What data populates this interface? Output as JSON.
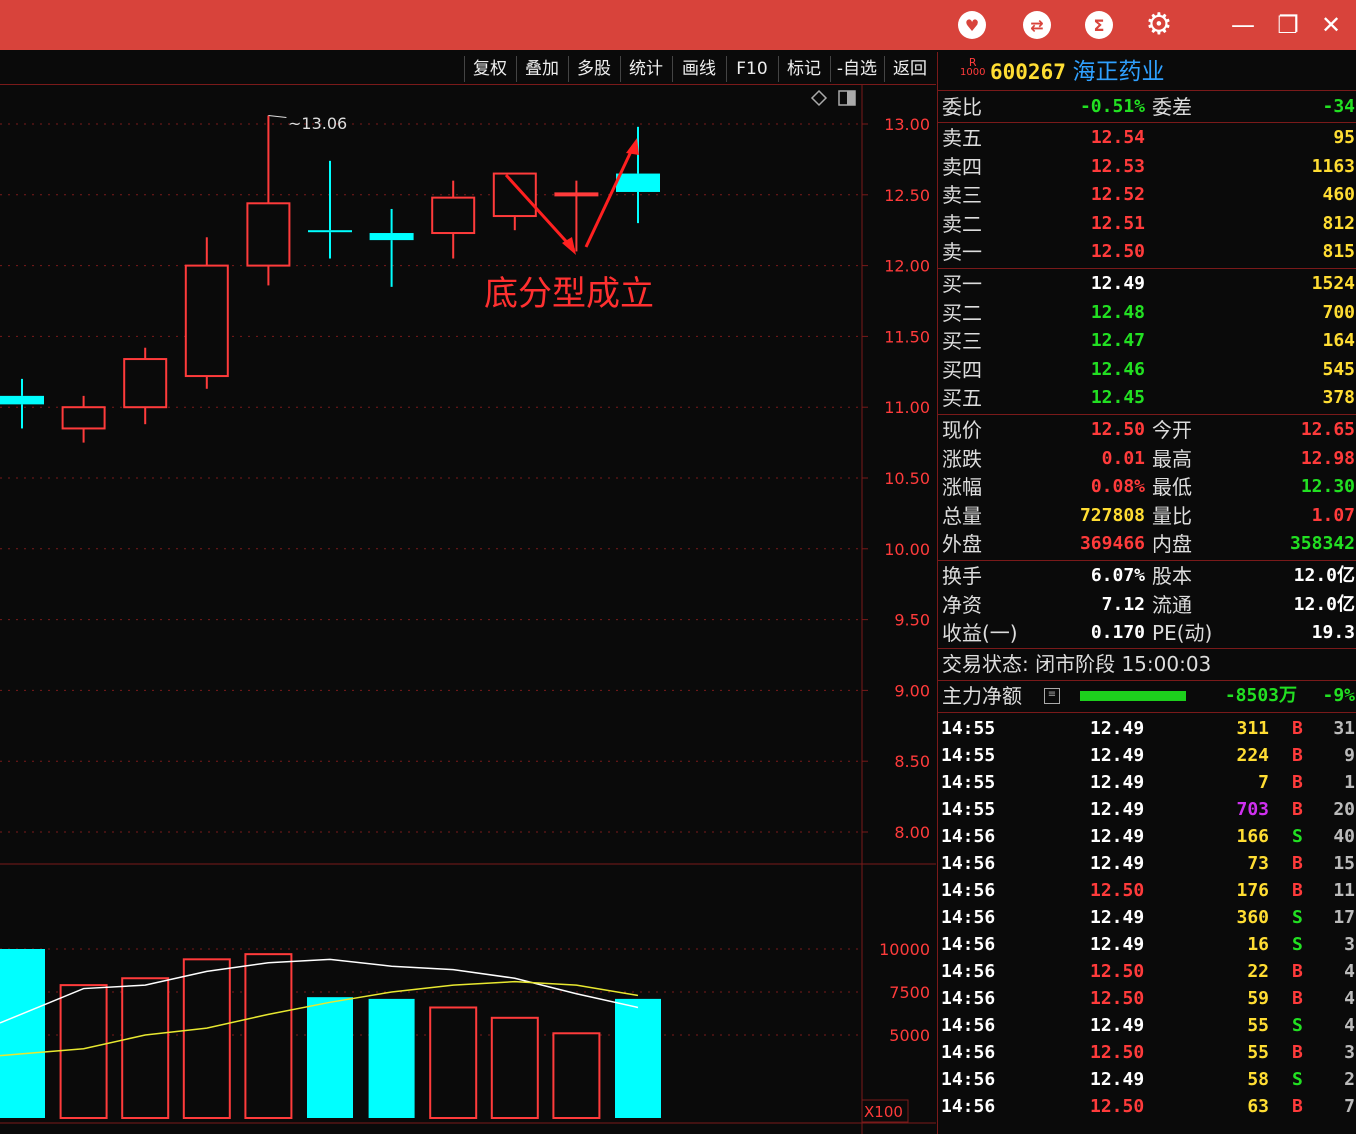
{
  "toolbar": {
    "buttons": [
      "复权",
      "叠加",
      "多股",
      "统计",
      "画线",
      "F10",
      "标记",
      "-自选",
      "返回"
    ],
    "window_controls": {
      "minimize": "—",
      "restore": "❐",
      "close": "✕"
    }
  },
  "chart": {
    "price_axis_labels": [
      "13.00",
      "12.50",
      "12.00",
      "11.50",
      "11.00",
      "10.50",
      "10.00",
      "9.50",
      "9.00",
      "8.50",
      "8.00"
    ],
    "volume_axis_labels": [
      "10000",
      "7500",
      "5000"
    ],
    "volume_unit": "X100",
    "high_marker": "13.06",
    "annotation": "底分型成立"
  },
  "chart_data": {
    "type": "candlestick",
    "candles": [
      {
        "open": 11.08,
        "close": 11.02,
        "high": 11.2,
        "low": 10.85,
        "color": "cyan"
      },
      {
        "open": 10.85,
        "close": 11.0,
        "high": 11.08,
        "low": 10.75,
        "color": "red"
      },
      {
        "open": 11.0,
        "close": 11.34,
        "high": 11.42,
        "low": 10.88,
        "color": "red"
      },
      {
        "open": 11.22,
        "close": 12.0,
        "high": 12.2,
        "low": 11.13,
        "color": "red"
      },
      {
        "open": 12.0,
        "close": 12.44,
        "high": 13.06,
        "low": 11.86,
        "color": "red"
      },
      {
        "open": 12.25,
        "close": 12.24,
        "high": 12.74,
        "low": 12.05,
        "color": "cyan"
      },
      {
        "open": 12.23,
        "close": 12.18,
        "high": 12.4,
        "low": 11.85,
        "color": "cyan"
      },
      {
        "open": 12.23,
        "close": 12.48,
        "high": 12.6,
        "low": 12.05,
        "color": "red"
      },
      {
        "open": 12.35,
        "close": 12.65,
        "high": 12.65,
        "low": 12.25,
        "color": "red"
      },
      {
        "open": 12.5,
        "close": 12.51,
        "high": 12.6,
        "low": 12.1,
        "color": "red"
      },
      {
        "open": 12.65,
        "close": 12.52,
        "high": 12.98,
        "low": 12.3,
        "color": "cyan"
      }
    ],
    "volume": [
      {
        "value": 10000,
        "color": "cyan"
      },
      {
        "value": 7900,
        "color": "red"
      },
      {
        "value": 8300,
        "color": "red"
      },
      {
        "value": 9400,
        "color": "red"
      },
      {
        "value": 9700,
        "color": "red"
      },
      {
        "value": 7200,
        "color": "cyan"
      },
      {
        "value": 7100,
        "color": "cyan"
      },
      {
        "value": 6600,
        "color": "red"
      },
      {
        "value": 6000,
        "color": "red"
      },
      {
        "value": 5100,
        "color": "red"
      },
      {
        "value": 7100,
        "color": "cyan"
      }
    ],
    "vol_ma_white": [
      5700,
      7700,
      7900,
      8700,
      9200,
      9400,
      9000,
      8800,
      8300,
      7400,
      6600
    ],
    "vol_ma_yellow": [
      3800,
      4200,
      5000,
      5400,
      6200,
      6900,
      7500,
      7900,
      8100,
      7900,
      7300
    ],
    "price_range": [
      7.9,
      13.2
    ],
    "volume_range": [
      0,
      13000
    ]
  },
  "quote": {
    "code": "600267",
    "name": "海正药业",
    "badge_top": "R",
    "badge_bottom": "1000",
    "weibi_label": "委比",
    "weibi": "-0.51%",
    "weicha_label": "委差",
    "weicha": "-34",
    "asks": [
      {
        "label": "卖五",
        "price": "12.54",
        "vol": "95"
      },
      {
        "label": "卖四",
        "price": "12.53",
        "vol": "1163"
      },
      {
        "label": "卖三",
        "price": "12.52",
        "vol": "460"
      },
      {
        "label": "卖二",
        "price": "12.51",
        "vol": "812"
      },
      {
        "label": "卖一",
        "price": "12.50",
        "vol": "815"
      }
    ],
    "bids": [
      {
        "label": "买一",
        "price": "12.49",
        "vol": "1524"
      },
      {
        "label": "买二",
        "price": "12.48",
        "vol": "700"
      },
      {
        "label": "买三",
        "price": "12.47",
        "vol": "164"
      },
      {
        "label": "买四",
        "price": "12.46",
        "vol": "545"
      },
      {
        "label": "买五",
        "price": "12.45",
        "vol": "378"
      }
    ],
    "stats": [
      {
        "l1": "现价",
        "v1": "12.50",
        "c1": "red",
        "l2": "今开",
        "v2": "12.65",
        "c2": "red"
      },
      {
        "l1": "涨跌",
        "v1": "0.01",
        "c1": "red",
        "l2": "最高",
        "v2": "12.98",
        "c2": "red"
      },
      {
        "l1": "涨幅",
        "v1": "0.08%",
        "c1": "red",
        "l2": "最低",
        "v2": "12.30",
        "c2": "green"
      },
      {
        "l1": "总量",
        "v1": "727808",
        "c1": "yellow",
        "l2": "量比",
        "v2": "1.07",
        "c2": "red"
      },
      {
        "l1": "外盘",
        "v1": "369466",
        "c1": "red",
        "l2": "内盘",
        "v2": "358342",
        "c2": "green"
      }
    ],
    "stats2": [
      {
        "l1": "换手",
        "v1": "6.07%",
        "l2": "股本",
        "v2": "12.0亿"
      },
      {
        "l1": "净资",
        "v1": "7.12",
        "l2": "流通",
        "v2": "12.0亿"
      },
      {
        "l1": "收益(一)",
        "v1": "0.170",
        "l2": "PE(动)",
        "v2": "19.3"
      }
    ],
    "trade_status": "交易状态: 闭市阶段 15:00:03",
    "main_force_label": "主力净额",
    "main_force_value": "-8503万",
    "main_force_pct": "-9%"
  },
  "ticks": [
    {
      "t": "14:55",
      "p": "12.49",
      "pc": "white",
      "v": "311",
      "vc": "yellow",
      "bs": "B",
      "n": "31"
    },
    {
      "t": "14:55",
      "p": "12.49",
      "pc": "white",
      "v": "224",
      "vc": "yellow",
      "bs": "B",
      "n": "9"
    },
    {
      "t": "14:55",
      "p": "12.49",
      "pc": "white",
      "v": "7",
      "vc": "yellow",
      "bs": "B",
      "n": "1"
    },
    {
      "t": "14:55",
      "p": "12.49",
      "pc": "white",
      "v": "703",
      "vc": "mag",
      "bs": "B",
      "n": "20"
    },
    {
      "t": "14:56",
      "p": "12.49",
      "pc": "white",
      "v": "166",
      "vc": "yellow",
      "bs": "S",
      "n": "40"
    },
    {
      "t": "14:56",
      "p": "12.49",
      "pc": "white",
      "v": "73",
      "vc": "yellow",
      "bs": "B",
      "n": "15"
    },
    {
      "t": "14:56",
      "p": "12.50",
      "pc": "red",
      "v": "176",
      "vc": "yellow",
      "bs": "B",
      "n": "11"
    },
    {
      "t": "14:56",
      "p": "12.49",
      "pc": "white",
      "v": "360",
      "vc": "yellow",
      "bs": "S",
      "n": "17"
    },
    {
      "t": "14:56",
      "p": "12.49",
      "pc": "white",
      "v": "16",
      "vc": "yellow",
      "bs": "S",
      "n": "3"
    },
    {
      "t": "14:56",
      "p": "12.50",
      "pc": "red",
      "v": "22",
      "vc": "yellow",
      "bs": "B",
      "n": "4"
    },
    {
      "t": "14:56",
      "p": "12.50",
      "pc": "red",
      "v": "59",
      "vc": "yellow",
      "bs": "B",
      "n": "4"
    },
    {
      "t": "14:56",
      "p": "12.49",
      "pc": "white",
      "v": "55",
      "vc": "yellow",
      "bs": "S",
      "n": "4"
    },
    {
      "t": "14:56",
      "p": "12.50",
      "pc": "red",
      "v": "55",
      "vc": "yellow",
      "bs": "B",
      "n": "3"
    },
    {
      "t": "14:56",
      "p": "12.49",
      "pc": "white",
      "v": "58",
      "vc": "yellow",
      "bs": "S",
      "n": "2"
    },
    {
      "t": "14:56",
      "p": "12.50",
      "pc": "red",
      "v": "63",
      "vc": "yellow",
      "bs": "B",
      "n": "7"
    }
  ],
  "colors": {
    "titlebar": "#d8433b",
    "up": "#ff3b3b",
    "down": "#00ffff",
    "grid": "#7a1a1a",
    "ma_white": "#ffffff",
    "ma_yellow": "#e8e830"
  }
}
